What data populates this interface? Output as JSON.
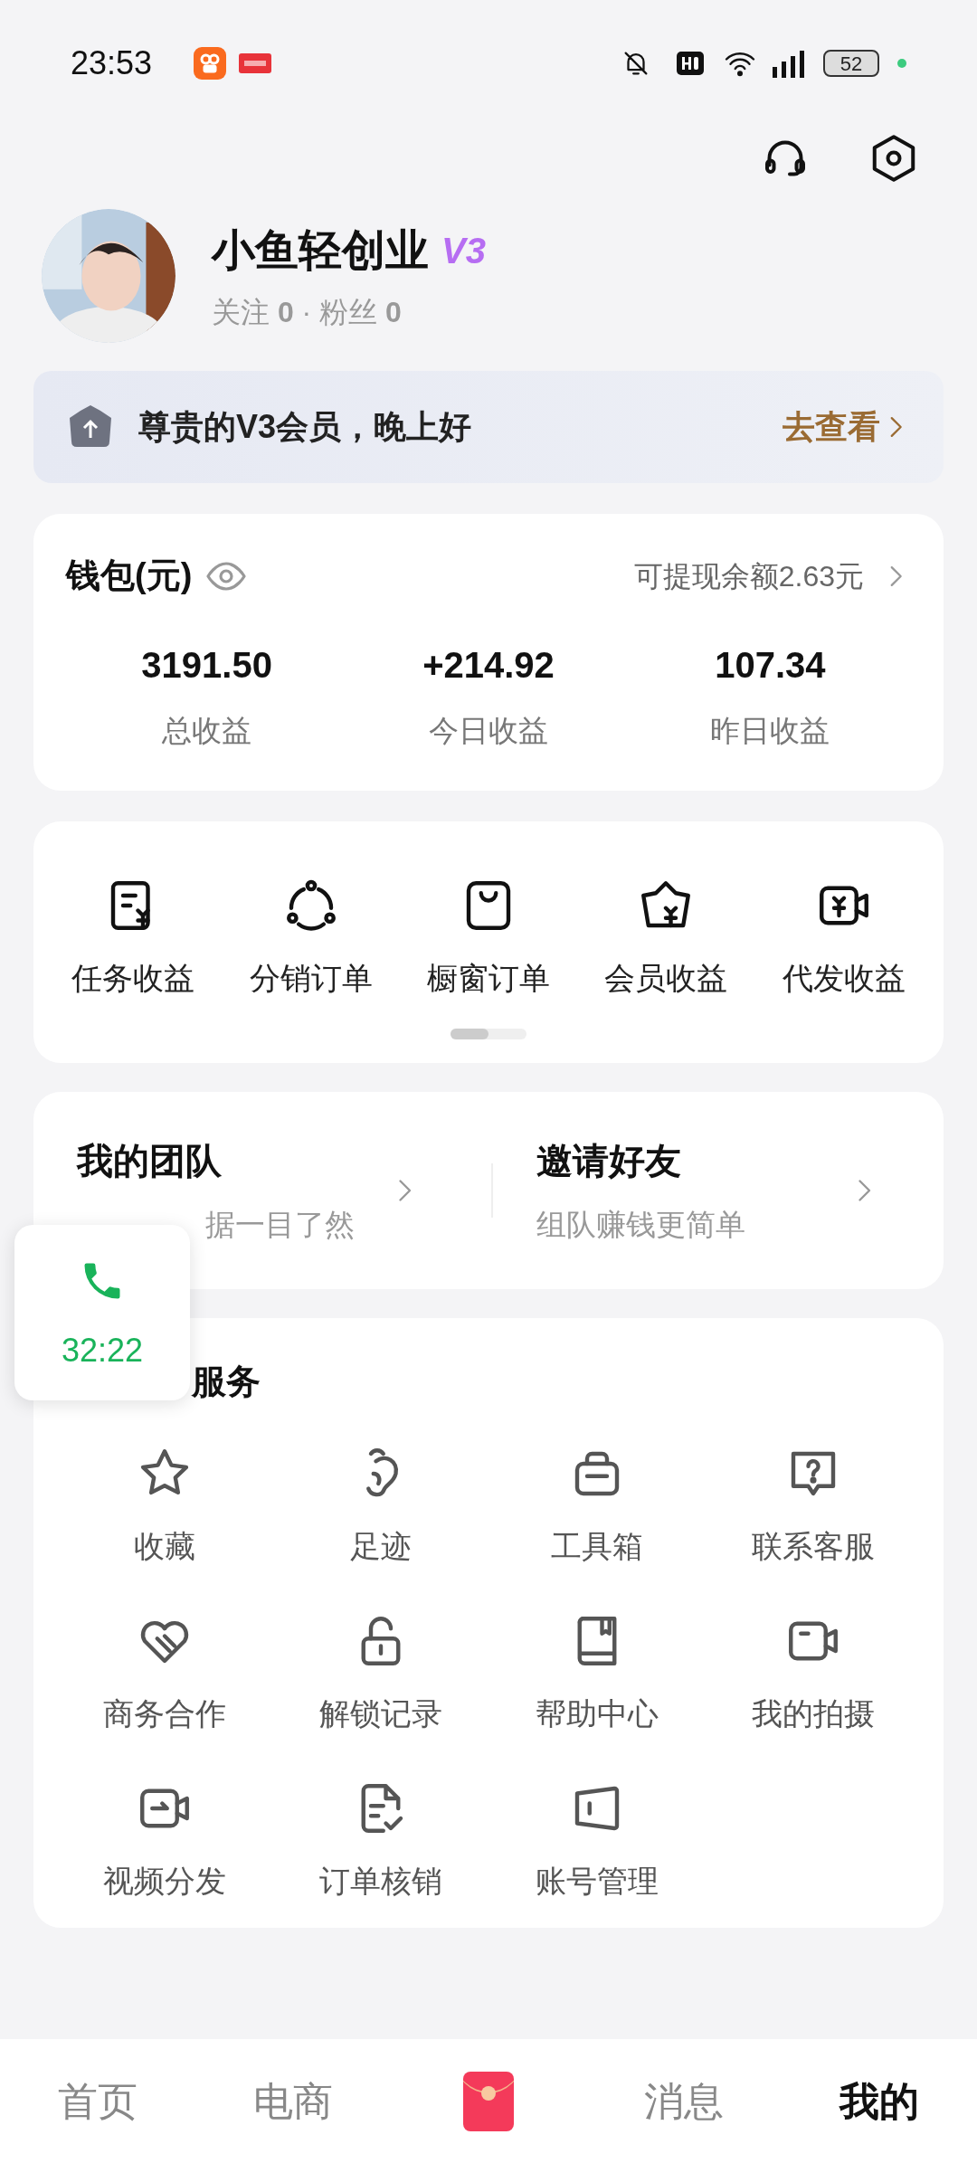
{
  "status_bar": {
    "time": "23:53",
    "battery": "52"
  },
  "profile": {
    "name": "小鱼轻创业",
    "badge": "V3",
    "stats": "关注 **0** · 粉丝 **0**"
  },
  "banner": {
    "text": "尊贵的V3会员，晚上好",
    "action": "去查看"
  },
  "wallet": {
    "title": "钱包(元)",
    "withdrawable": "可提现余额2.63元",
    "stats": [
      {
        "value": "3191.50",
        "label": "总收益"
      },
      {
        "value": "+214.92",
        "label": "今日收益"
      },
      {
        "value": "107.34",
        "label": "昨日收益"
      }
    ]
  },
  "shortcuts": [
    {
      "label": "任务收益"
    },
    {
      "label": "分销订单"
    },
    {
      "label": "橱窗订单"
    },
    {
      "label": "会员收益"
    },
    {
      "label": "代发收益"
    }
  ],
  "team": [
    {
      "title": "我的团队",
      "subtitle": "据一目了然"
    },
    {
      "title": "邀请好友",
      "subtitle": "组队赚钱更简单"
    }
  ],
  "floating_call": {
    "time": "32:22"
  },
  "services": {
    "title": "服务",
    "items": [
      {
        "label": "收藏"
      },
      {
        "label": "足迹"
      },
      {
        "label": "工具箱"
      },
      {
        "label": "联系客服"
      },
      {
        "label": "商务合作"
      },
      {
        "label": "解锁记录"
      },
      {
        "label": "帮助中心"
      },
      {
        "label": "我的拍摄"
      },
      {
        "label": "视频分发"
      },
      {
        "label": "订单核销"
      },
      {
        "label": "账号管理"
      }
    ]
  },
  "bottom_nav": [
    {
      "kind": "text",
      "label": "首页",
      "selected": false
    },
    {
      "kind": "text",
      "label": "电商",
      "selected": false
    },
    {
      "kind": "icon",
      "selected": false
    },
    {
      "kind": "text",
      "label": "消息",
      "selected": false
    },
    {
      "kind": "text",
      "label": "我的",
      "selected": true
    }
  ]
}
